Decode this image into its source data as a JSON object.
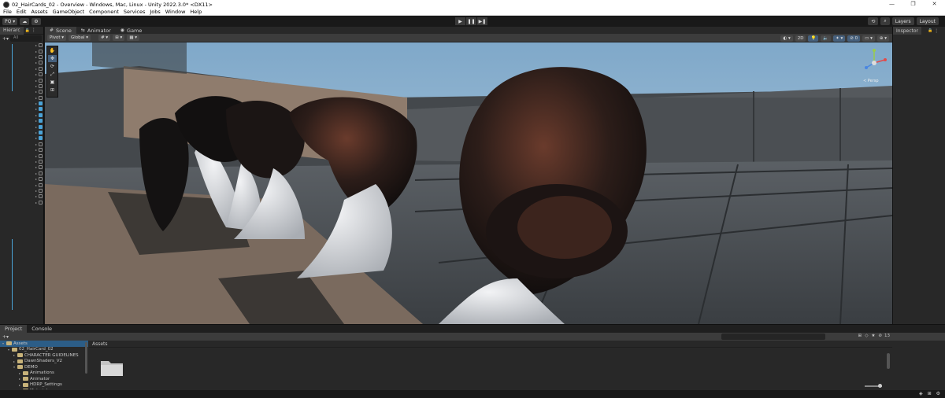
{
  "window": {
    "title": "02_HairCards_02 - Overview - Windows, Mac, Linux - Unity 2022.3.0* <DX11>",
    "controls": [
      "—",
      "❐",
      "✕"
    ]
  },
  "menu": [
    "File",
    "Edit",
    "Assets",
    "GameObject",
    "Component",
    "Services",
    "Jobs",
    "Window",
    "Help"
  ],
  "toolbar": {
    "account_label": "PQ ▾",
    "cloud_icon": "☁",
    "collab_icon": "⚙",
    "play": "▶",
    "pause": "❚❚",
    "step": "▶❚",
    "history_icon": "⟲",
    "search_icon": "⌕",
    "layers": "Layers",
    "layout": "Layout"
  },
  "hierarchy": {
    "tab": "Hierarc",
    "lock_icon": "🔒",
    "menu_icon": "⋮",
    "add_icon": "+▾",
    "search_placeholder": "All"
  },
  "scene_tabs": [
    {
      "icon": "#",
      "label": "Scene"
    },
    {
      "icon": "⇆",
      "label": "Animator"
    },
    {
      "icon": "◉",
      "label": "Game"
    }
  ],
  "scene_toolbar": {
    "pivot": "Pivot ▾",
    "global": "Global ▾",
    "grid_snap": "# ▾",
    "snap_increment": "⊞ ▾",
    "snap_settings": "▦ ▾",
    "draw_mode": "◐ ▾",
    "mode_2d": "2D",
    "lighting": "💡",
    "audio": "🔈",
    "effects": "✦ ▾",
    "hidden": "⊘ 0",
    "camera": "▭ ▾",
    "gizmos": "⊕ ▾"
  },
  "tools": [
    "✋",
    "✥",
    "⟳",
    "⤢",
    "▣",
    "⊞"
  ],
  "gizmo_label": "< Persp",
  "inspector": {
    "tab": "Inspector",
    "lock_icon": "🔒",
    "menu_icon": "⋮"
  },
  "project": {
    "tabs": [
      "Project",
      "Console"
    ],
    "add_icon": "+▾",
    "breadcrumb": "Assets",
    "hidden_count": "13",
    "tree": [
      {
        "label": "Assets",
        "depth": 0,
        "selected": true,
        "open": true
      },
      {
        "label": "02_HairCard_02",
        "depth": 1,
        "selected": false,
        "open": true
      },
      {
        "label": "CHARACTER GUIDELINES",
        "depth": 2,
        "selected": false,
        "open": false
      },
      {
        "label": "DawnShaders_V2",
        "depth": 2,
        "selected": false,
        "open": false
      },
      {
        "label": "DEMO",
        "depth": 2,
        "selected": false,
        "open": true
      },
      {
        "label": "Animations",
        "depth": 3,
        "selected": false,
        "open": false
      },
      {
        "label": "Animator",
        "depth": 3,
        "selected": false,
        "open": false
      },
      {
        "label": "HDRP_Settings",
        "depth": 3,
        "selected": false,
        "open": false
      },
      {
        "label": "Materials",
        "depth": 3,
        "selected": false,
        "open": false
      }
    ]
  },
  "status_icons": [
    "◈",
    "⊞",
    "⚙"
  ]
}
